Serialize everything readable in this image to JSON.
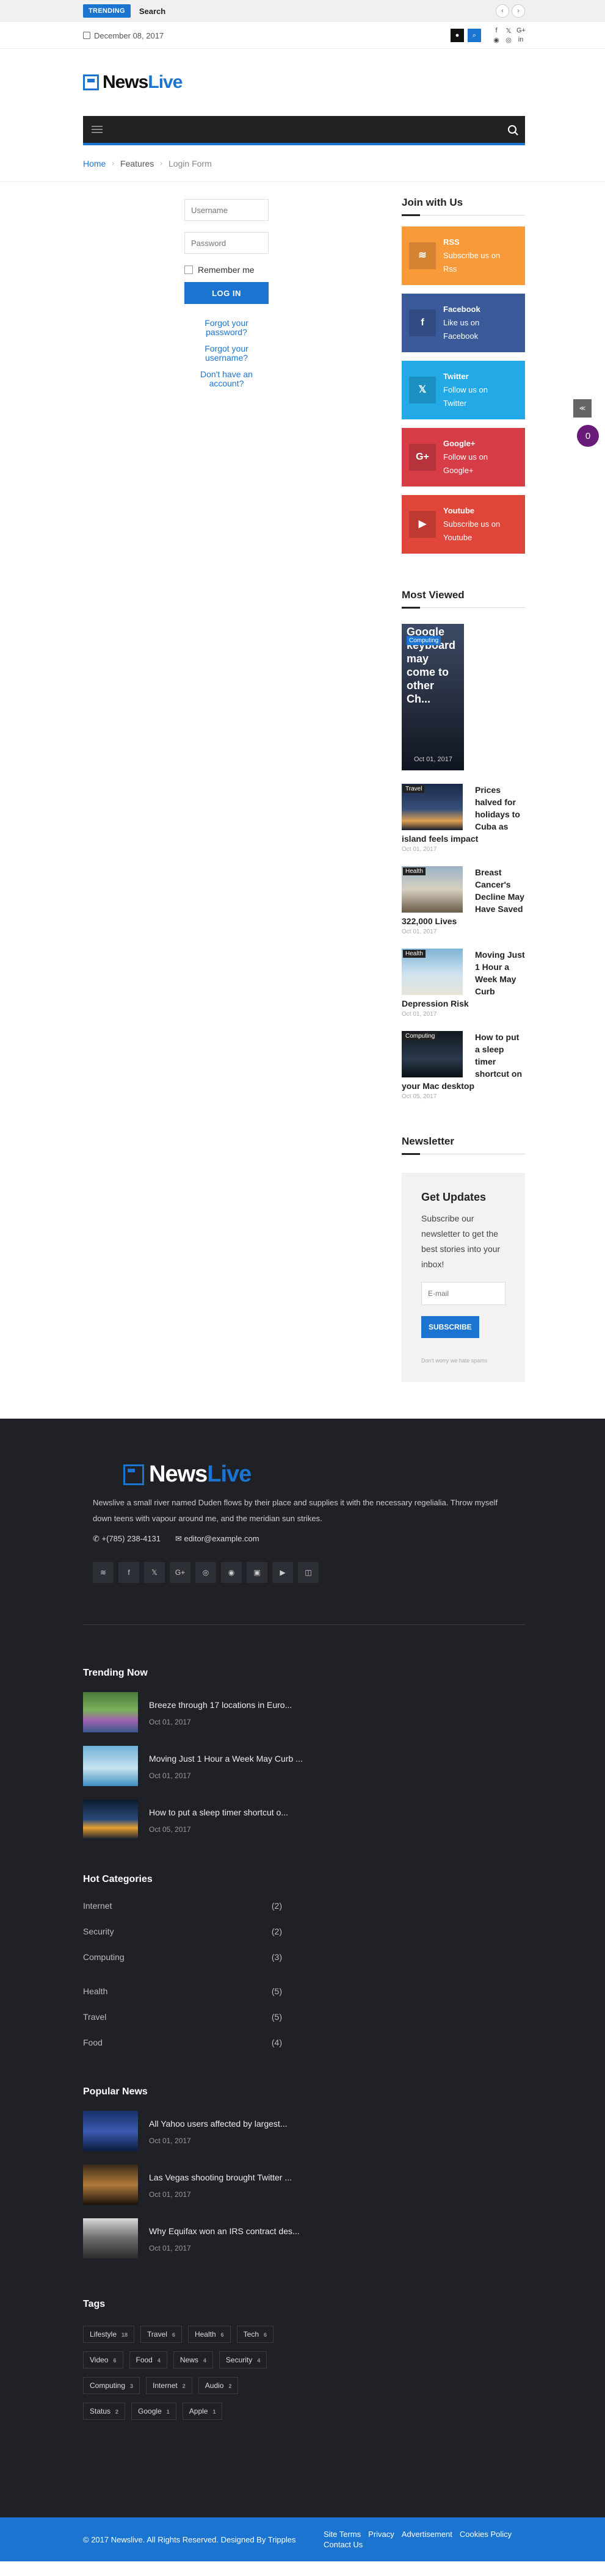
{
  "topbar": {
    "trending_label": "TRENDING",
    "trending_text": "Search",
    "prev": "‹",
    "next": "›"
  },
  "datebar": {
    "date": "December 08, 2017",
    "social": [
      "f",
      "𝕏",
      "G+",
      "◉",
      "◎",
      "in"
    ]
  },
  "logo": {
    "news": "News",
    "live": "Live"
  },
  "breadcrumb": {
    "home": "Home",
    "features": "Features",
    "current": "Login Form",
    "sep": "›"
  },
  "login": {
    "username_placeholder": "Username",
    "password_placeholder": "Password",
    "remember": "Remember me",
    "button": "LOG IN",
    "forgot_password": "Forgot your password?",
    "forgot_username": "Forgot your username?",
    "no_account": "Don't have an account?"
  },
  "sidebar": {
    "join_title": "Join with Us",
    "socials": [
      {
        "name": "RSS",
        "action": "Subscribe us on",
        "target": "Rss",
        "icon": "≋",
        "color": "#f89a3a"
      },
      {
        "name": "Facebook",
        "action": "Like us on",
        "target": "Facebook",
        "icon": "f",
        "color": "#3b5a9a"
      },
      {
        "name": "Twitter",
        "action": "Follow us on",
        "target": "Twitter",
        "icon": "𝕏",
        "color": "#22a9e6"
      },
      {
        "name": "Google+",
        "action": "Follow us on",
        "target": "Google+",
        "icon": "G+",
        "color": "#d63d47"
      },
      {
        "name": "Youtube",
        "action": "Subscribe us on",
        "target": "Youtube",
        "icon": "▶",
        "color": "#e0453a"
      }
    ],
    "most_viewed_title": "Most Viewed",
    "feature": {
      "category": "Computing",
      "title": "Google keyboard may come to other Ch...",
      "date": "Oct 01, 2017"
    },
    "most_viewed": [
      {
        "category": "Travel",
        "title": "Prices halved for holidays to Cuba as island feels impact",
        "date": "Oct 01, 2017"
      },
      {
        "category": "Health",
        "title": "Breast Cancer's Decline May Have Saved 322,000 Lives",
        "date": "Oct 01, 2017"
      },
      {
        "category": "Health",
        "title": "Moving Just 1 Hour a Week May Curb Depression Risk",
        "date": "Oct 01, 2017"
      },
      {
        "category": "Computing",
        "title": "How to put a sleep timer shortcut on your Mac desktop",
        "date": "Oct 05, 2017"
      }
    ],
    "newsletter_title": "Newsletter",
    "newsletter": {
      "heading": "Get Updates",
      "text": "Subscribe our newsletter to get the best stories into your inbox!",
      "placeholder": "E-mail",
      "button": "SUBSCRIBE",
      "note": "Don't worry we hate spams"
    }
  },
  "floating": {
    "share": "≪",
    "count": "0"
  },
  "footer": {
    "about": "Newslive a small river named Duden flows by their place and supplies it with the necessary regelialia. Throw myself down teens with vapour around me, and the meridian sun strikes.",
    "phone": "+(785) 238-4131",
    "email": "editor@example.com",
    "social": [
      "≋",
      "f",
      "𝕏",
      "G+",
      "◎",
      "◉",
      "▣",
      "▶",
      "◫"
    ],
    "trending_title": "Trending Now",
    "trending": [
      {
        "title": "Breeze through 17 locations in Euro...",
        "date": "Oct 01, 2017"
      },
      {
        "title": "Moving Just 1 Hour a Week May Curb ...",
        "date": "Oct 01, 2017"
      },
      {
        "title": "How to put a sleep timer shortcut o...",
        "date": "Oct 05, 2017"
      }
    ],
    "categories_title": "Hot Categories",
    "categories": [
      {
        "name": "Internet",
        "count": "(2)"
      },
      {
        "name": "Security",
        "count": "(2)"
      },
      {
        "name": "Computing",
        "count": "(3)"
      },
      {
        "name": "Health",
        "count": "(5)"
      },
      {
        "name": "Travel",
        "count": "(5)"
      },
      {
        "name": "Food",
        "count": "(4)"
      }
    ],
    "popular_title": "Popular News",
    "popular": [
      {
        "title": "All Yahoo users affected by largest...",
        "date": "Oct 01, 2017"
      },
      {
        "title": "Las Vegas shooting brought Twitter ...",
        "date": "Oct 01, 2017"
      },
      {
        "title": "Why Equifax won an IRS contract des...",
        "date": "Oct 01, 2017"
      }
    ],
    "tags_title": "Tags",
    "tags": [
      {
        "name": "Lifestyle",
        "count": "18"
      },
      {
        "name": "Travel",
        "count": "6"
      },
      {
        "name": "Health",
        "count": "6"
      },
      {
        "name": "Tech",
        "count": "6"
      },
      {
        "name": "Video",
        "count": "6"
      },
      {
        "name": "Food",
        "count": "4"
      },
      {
        "name": "News",
        "count": "4"
      },
      {
        "name": "Security",
        "count": "4"
      },
      {
        "name": "Computing",
        "count": "3"
      },
      {
        "name": "Internet",
        "count": "2"
      },
      {
        "name": "Audio",
        "count": "2"
      },
      {
        "name": "Status",
        "count": "2"
      },
      {
        "name": "Google",
        "count": "1"
      },
      {
        "name": "Apple",
        "count": "1"
      }
    ],
    "copyright": "© 2017 Newslive. All Rights Reserved. Designed By Tripples",
    "links": [
      "Site Terms",
      "Privacy",
      "Advertisement",
      "Cookies Policy",
      "Contact Us"
    ]
  },
  "colors": {
    "accent": "#1b75d0",
    "footer_bg": "#1f2126",
    "nav_bg": "#222222"
  }
}
